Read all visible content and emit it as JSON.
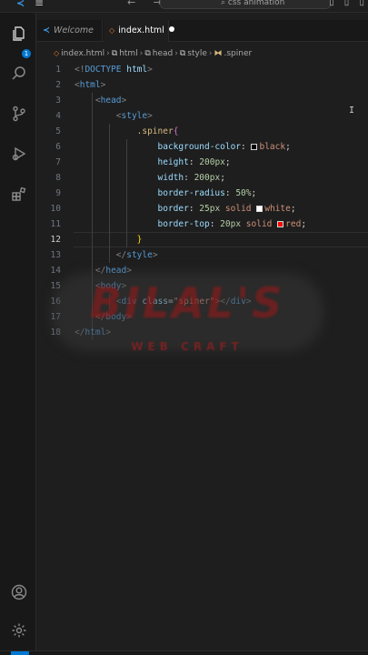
{
  "titlebar": {
    "menu": "≡",
    "nav": "← →",
    "search_text": "css animation",
    "window_controls": "▯ ▯ ▯"
  },
  "activity_bar": {
    "icons": [
      "explorer-icon",
      "search-icon",
      "source-control-icon",
      "run-debug-icon",
      "extensions-icon",
      "account-icon",
      "settings-gear-icon"
    ],
    "badge": "1"
  },
  "tabs": [
    {
      "label": "Welcome",
      "icon": "vscode-icon"
    },
    {
      "label": "index.html",
      "icon": "html-icon",
      "modified": true
    }
  ],
  "breadcrumb": [
    "index.html",
    "html",
    "head",
    "style",
    ".spiner"
  ],
  "editor": {
    "active_line": 12,
    "lines": [
      {
        "n": "1",
        "parts": [
          [
            "punct",
            "<!"
          ],
          [
            "tag",
            "DOCTYPE"
          ],
          [
            "txt",
            " "
          ],
          [
            "attr",
            "html"
          ],
          [
            "punct",
            ">"
          ]
        ]
      },
      {
        "n": "2",
        "parts": [
          [
            "punct",
            "<"
          ],
          [
            "tag",
            "html"
          ],
          [
            "punct",
            ">"
          ]
        ]
      },
      {
        "n": "3",
        "parts": [
          [
            "txt",
            "    "
          ],
          [
            "punct",
            "<"
          ],
          [
            "tag",
            "head"
          ],
          [
            "punct",
            ">"
          ]
        ]
      },
      {
        "n": "4",
        "parts": [
          [
            "txt",
            "        "
          ],
          [
            "punct",
            "<"
          ],
          [
            "tag",
            "style"
          ],
          [
            "punct",
            ">"
          ]
        ]
      },
      {
        "n": "5",
        "parts": [
          [
            "txt",
            "            "
          ],
          [
            "sel-c",
            ".spiner"
          ],
          [
            "brace",
            "{"
          ]
        ]
      },
      {
        "n": "6",
        "parts": [
          [
            "txt",
            "                "
          ],
          [
            "prop",
            "background-color"
          ],
          [
            "txt",
            ": "
          ],
          [
            "swatch",
            "#000000"
          ],
          [
            "val",
            "black"
          ],
          [
            "txt",
            ";"
          ]
        ]
      },
      {
        "n": "7",
        "parts": [
          [
            "txt",
            "                "
          ],
          [
            "prop",
            "height"
          ],
          [
            "txt",
            ": "
          ],
          [
            "num",
            "200px"
          ],
          [
            "txt",
            ";"
          ]
        ]
      },
      {
        "n": "8",
        "parts": [
          [
            "txt",
            "                "
          ],
          [
            "prop",
            "width"
          ],
          [
            "txt",
            ": "
          ],
          [
            "num",
            "200px"
          ],
          [
            "txt",
            ";"
          ]
        ]
      },
      {
        "n": "9",
        "parts": [
          [
            "txt",
            "                "
          ],
          [
            "prop",
            "border-radius"
          ],
          [
            "txt",
            ": "
          ],
          [
            "num",
            "50%"
          ],
          [
            "txt",
            ";"
          ]
        ]
      },
      {
        "n": "10",
        "parts": [
          [
            "txt",
            "                "
          ],
          [
            "prop",
            "border"
          ],
          [
            "txt",
            ": "
          ],
          [
            "num",
            "25px"
          ],
          [
            "txt",
            " "
          ],
          [
            "val",
            "solid"
          ],
          [
            "txt",
            " "
          ],
          [
            "swatch",
            "#ffffff"
          ],
          [
            "val",
            "white"
          ],
          [
            "txt",
            ";"
          ]
        ]
      },
      {
        "n": "11",
        "parts": [
          [
            "txt",
            "                "
          ],
          [
            "prop",
            "border-top"
          ],
          [
            "txt",
            ": "
          ],
          [
            "num",
            "20px"
          ],
          [
            "txt",
            " "
          ],
          [
            "val",
            "solid"
          ],
          [
            "txt",
            " "
          ],
          [
            "swatch",
            "#ff0000"
          ],
          [
            "val",
            "red"
          ],
          [
            "txt",
            ";"
          ]
        ]
      },
      {
        "n": "12",
        "parts": [
          [
            "txt",
            "            "
          ],
          [
            "brace-y",
            "}"
          ]
        ]
      },
      {
        "n": "13",
        "parts": [
          [
            "txt",
            "        "
          ],
          [
            "punct",
            "</"
          ],
          [
            "tag",
            "style"
          ],
          [
            "punct",
            ">"
          ]
        ]
      },
      {
        "n": "14",
        "parts": [
          [
            "txt",
            "    "
          ],
          [
            "punct",
            "</"
          ],
          [
            "tag",
            "head"
          ],
          [
            "punct",
            ">"
          ]
        ]
      },
      {
        "n": "15",
        "parts": [
          [
            "txt",
            "    "
          ],
          [
            "punct",
            "<"
          ],
          [
            "tag",
            "body"
          ],
          [
            "punct",
            ">"
          ]
        ]
      },
      {
        "n": "16",
        "parts": [
          [
            "txt",
            "        "
          ],
          [
            "punct",
            "<"
          ],
          [
            "tag",
            "div"
          ],
          [
            "txt",
            " "
          ],
          [
            "attr",
            "class"
          ],
          [
            "txt",
            "="
          ],
          [
            "str",
            "\"spiner\""
          ],
          [
            "punct",
            "></"
          ],
          [
            "tag",
            "div"
          ],
          [
            "punct",
            ">"
          ]
        ]
      },
      {
        "n": "17",
        "parts": [
          [
            "txt",
            "    "
          ],
          [
            "punct",
            "</"
          ],
          [
            "tag",
            "body"
          ],
          [
            "punct",
            ">"
          ]
        ]
      },
      {
        "n": "18",
        "parts": [
          [
            "punct",
            "</"
          ],
          [
            "tag",
            "html"
          ],
          [
            "punct",
            ">"
          ]
        ]
      }
    ]
  },
  "watermark": {
    "title": "BILAL'S",
    "subtitle": "WEB CRAFT"
  },
  "cursor_glyph": "I",
  "colors": {
    "accent": "#0078d4",
    "html_icon": "#e37933",
    "vscode": "#3b9ae8"
  }
}
